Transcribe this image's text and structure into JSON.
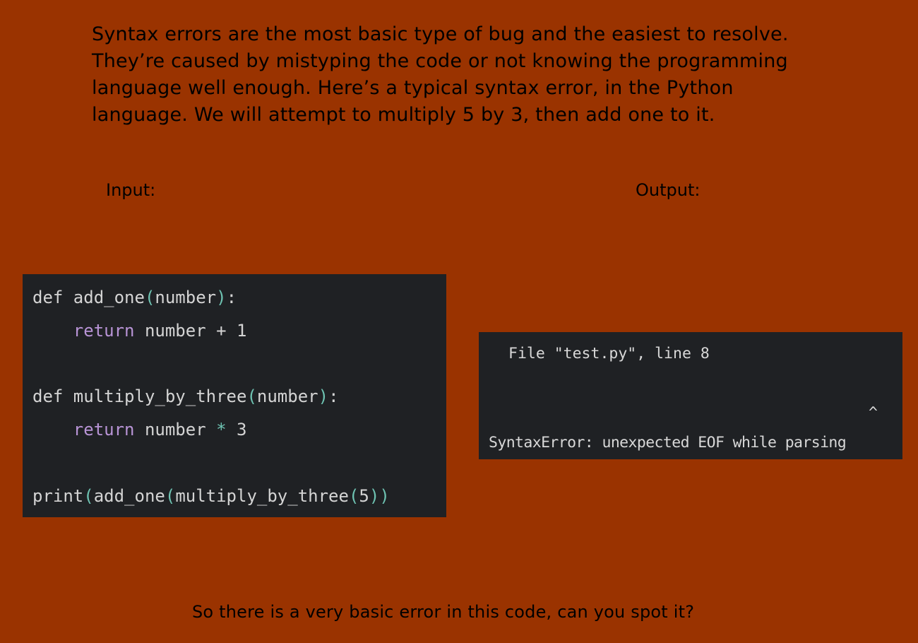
{
  "intro_text": "Syntax errors are the most basic type of bug and the easiest to resolve. They’re caused by mistyping the code or not knowing the programming language well enough. Here’s a typical syntax error, in the Python language. We will attempt to multiply 5 by 3, then add one to it.",
  "labels": {
    "input": "Input:",
    "output": "Output:"
  },
  "code": {
    "line1": {
      "kw": "def",
      "name": " add_one",
      "open": "(",
      "arg": "number",
      "close": ")",
      "end": ":"
    },
    "line2": {
      "indent": "    ",
      "ret": "return",
      "rest": " number + 1"
    },
    "line4": {
      "kw": "def",
      "name": " multiply_by_three",
      "open": "(",
      "arg": "number",
      "close": ")",
      "end": ":"
    },
    "line5": {
      "indent": "    ",
      "ret": "return",
      "rest1": " number ",
      "op": "*",
      "rest2": " 3"
    },
    "line7": {
      "fn1": "print",
      "o1": "(",
      "fn2": "add_one",
      "o2": "(",
      "fn3": "multiply_by_three",
      "o3": "(",
      "arg": "5",
      "c3": ")",
      "c2": ")"
    }
  },
  "output": {
    "file_line": "File \"test.py\", line 8",
    "caret": "^",
    "error_line": "SyntaxError: unexpected EOF while parsing"
  },
  "question_text": "So there is a very basic error in this code, can you spot it?"
}
